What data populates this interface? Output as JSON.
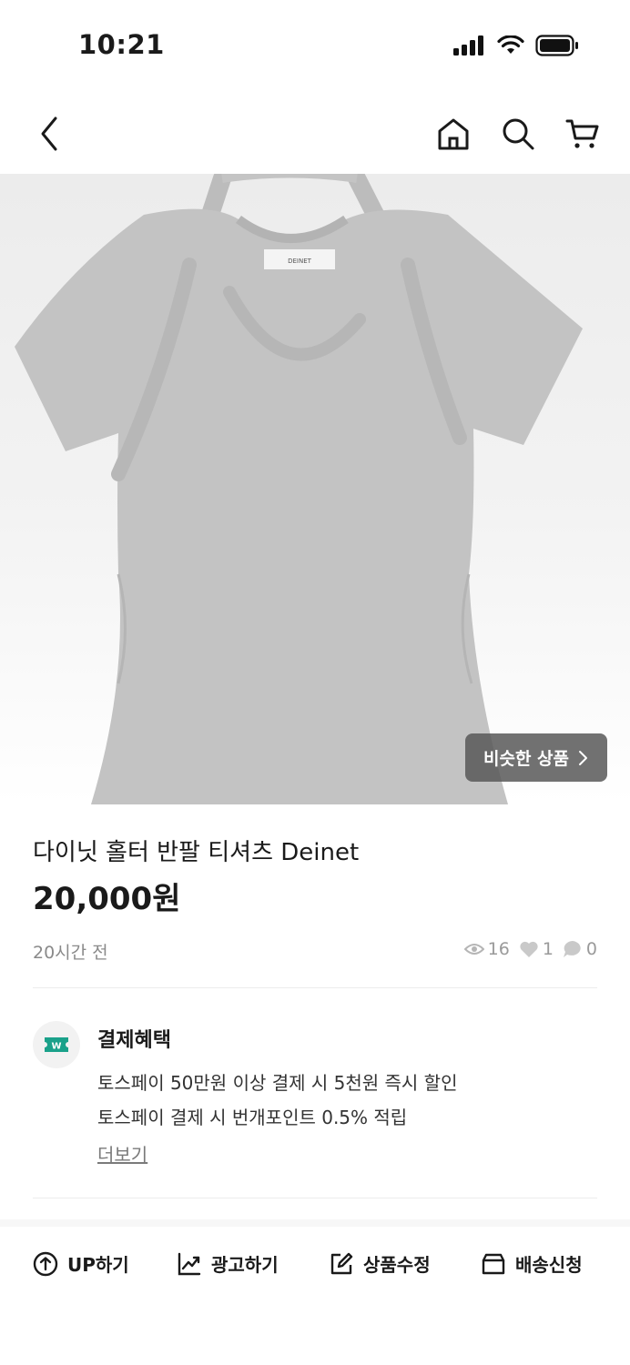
{
  "status_bar": {
    "time": "10:21"
  },
  "nav": {
    "back": "back",
    "home": "home",
    "search": "search",
    "cart": "cart"
  },
  "product": {
    "label_text": "DEINET",
    "similar_button": "비슷한 상품",
    "title": "다이닛 홀터 반팔 티셔츠 Deinet",
    "price": "20,000원",
    "posted": "20시간 전",
    "views": "16",
    "likes": "1",
    "comments": "0"
  },
  "benefit": {
    "title": "결제혜택",
    "line1": "토스페이 50만원 이상 결제 시 5천원 즉시 할인",
    "line2": "토스페이 결제 시 번개포인트 0.5% 적립",
    "more": "더보기"
  },
  "actions": [
    {
      "label": "UP하기",
      "icon": "arrow-up-circle-icon"
    },
    {
      "label": "광고하기",
      "icon": "trend-chart-icon"
    },
    {
      "label": "상품수정",
      "icon": "edit-icon"
    },
    {
      "label": "배송신청",
      "icon": "box-icon"
    }
  ]
}
